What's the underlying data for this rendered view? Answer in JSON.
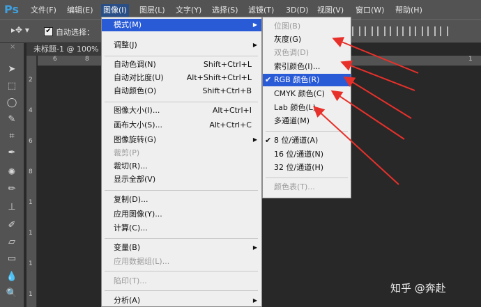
{
  "app": {
    "logo": "Ps"
  },
  "menubar": {
    "items": [
      "文件(F)",
      "编辑(E)",
      "图像(I)",
      "图层(L)",
      "文字(Y)",
      "选择(S)",
      "滤镜(T)",
      "3D(D)",
      "视图(V)",
      "窗口(W)",
      "帮助(H)"
    ],
    "active": "图像(I)"
  },
  "options": {
    "auto_select_label": "自动选择：",
    "auto_select_checked": "✔"
  },
  "document": {
    "tab_title": "未标题-1 @ 100%",
    "close": "×"
  },
  "ruler": {
    "h_ticks": [
      "6",
      "8",
      "1"
    ],
    "v_ticks": [
      "2",
      "4",
      "6",
      "8",
      "1",
      "1",
      "1",
      "1"
    ]
  },
  "image_menu": {
    "mode": "模式(M)",
    "adjust": "调整(J)",
    "auto_tone": {
      "label": "自动色调(N)",
      "shortcut": "Shift+Ctrl+L"
    },
    "auto_contrast": {
      "label": "自动对比度(U)",
      "shortcut": "Alt+Shift+Ctrl+L"
    },
    "auto_color": {
      "label": "自动颜色(O)",
      "shortcut": "Shift+Ctrl+B"
    },
    "image_size": {
      "label": "图像大小(I)...",
      "shortcut": "Alt+Ctrl+I"
    },
    "canvas_size": {
      "label": "画布大小(S)...",
      "shortcut": "Alt+Ctrl+C"
    },
    "rotation": "图像旋转(G)",
    "crop": "裁剪(P)",
    "trim": "裁切(R)...",
    "reveal_all": "显示全部(V)",
    "duplicate": "复制(D)...",
    "apply_image": "应用图像(Y)...",
    "calculations": "计算(C)...",
    "variables": "变量(B)",
    "apply_dataset": "应用数据组(L)...",
    "trap": "陷印(T)...",
    "analysis": "分析(A)"
  },
  "mode_menu": {
    "bitmap": "位图(B)",
    "grayscale": "灰度(G)",
    "duotone": "双色调(D)",
    "indexed": "索引颜色(I)...",
    "rgb": "RGB 颜色(R)",
    "cmyk": "CMYK 颜色(C)",
    "lab": "Lab 颜色(L)",
    "multichannel": "多通道(M)",
    "bits8": "8 位/通道(A)",
    "bits16": "16 位/通道(N)",
    "bits32": "32 位/通道(H)",
    "color_table": "颜色表(T)...",
    "check": "✔"
  },
  "watermark": "知乎 @奔赴",
  "colors": {
    "highlight": "#2a5bd7",
    "arrow": "#e8302a"
  }
}
